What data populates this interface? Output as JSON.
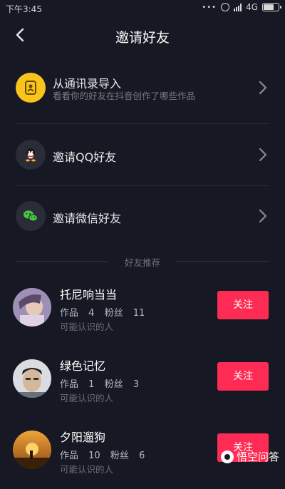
{
  "status": {
    "time": "下午3:45",
    "dots": "•••",
    "network": "4G"
  },
  "header": {
    "title": "邀请好友"
  },
  "options": [
    {
      "title": "从通讯录导入",
      "subtitle": "看看你的好友在抖音创作了哪些作品",
      "icon": "contacts-icon",
      "color": "#f8c31a"
    },
    {
      "title": "邀请QQ好友",
      "icon": "qq-icon",
      "color": "#2a2c37"
    },
    {
      "title": "邀请微信好友",
      "icon": "wechat-icon",
      "color": "#2a2c37"
    }
  ],
  "section_label": "好友推荐",
  "users": [
    {
      "name": "托尼响当当",
      "works_label": "作品",
      "works": "4",
      "fans_label": "粉丝",
      "fans": "11",
      "hint": "可能认识的人",
      "button": "关注"
    },
    {
      "name": "绿色记忆",
      "works_label": "作品",
      "works": "1",
      "fans_label": "粉丝",
      "fans": "3",
      "hint": "可能认识的人",
      "button": "关注"
    },
    {
      "name": "夕阳遛狗",
      "works_label": "作品",
      "works": "10",
      "fans_label": "粉丝",
      "fans": "6",
      "hint": "可能认识的人",
      "button": "关注"
    }
  ],
  "watermark": "悟空问答",
  "accent": "#fe2c55"
}
